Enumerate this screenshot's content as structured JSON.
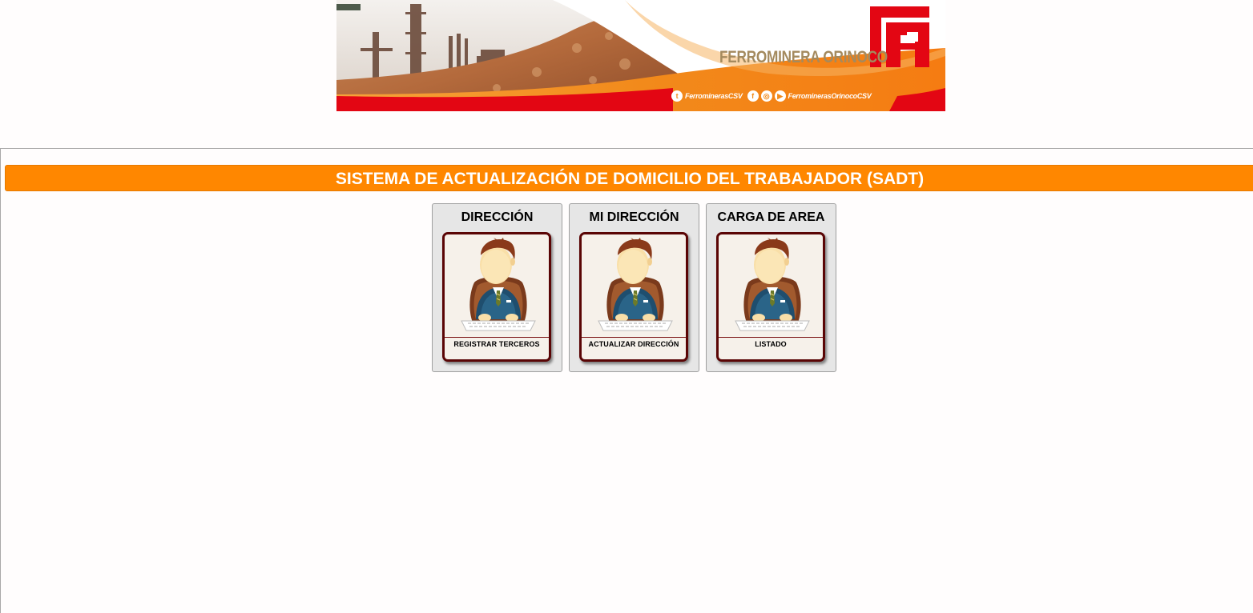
{
  "banner": {
    "brand": "FERROMINERA ORINOCO",
    "twitter_handle": "FerrominerasCSV",
    "youtube_handle": "FerrominerasOrinocoCSV"
  },
  "page_title": "SISTEMA DE ACTUALIZACIÓN DE DOMICILIO DEL TRABAJADOR (SADT)",
  "cards": [
    {
      "title": "DIRECCIÓN",
      "label": "REGISTRAR TERCEROS"
    },
    {
      "title": "MI DIRECCIÓN",
      "label": "ACTUALIZAR DIRECCIÓN"
    },
    {
      "title": "CARGA DE AREA",
      "label": "LISTADO"
    }
  ],
  "colors": {
    "accent": "#ff8700",
    "tile_border": "#5a0505",
    "brand_red": "#e30613",
    "brand_gold": "#a48a5e"
  },
  "icons": [
    "office-worker-icon",
    "twitter-icon",
    "facebook-icon",
    "instagram-icon",
    "youtube-icon",
    "ferrominera-logo-icon"
  ]
}
